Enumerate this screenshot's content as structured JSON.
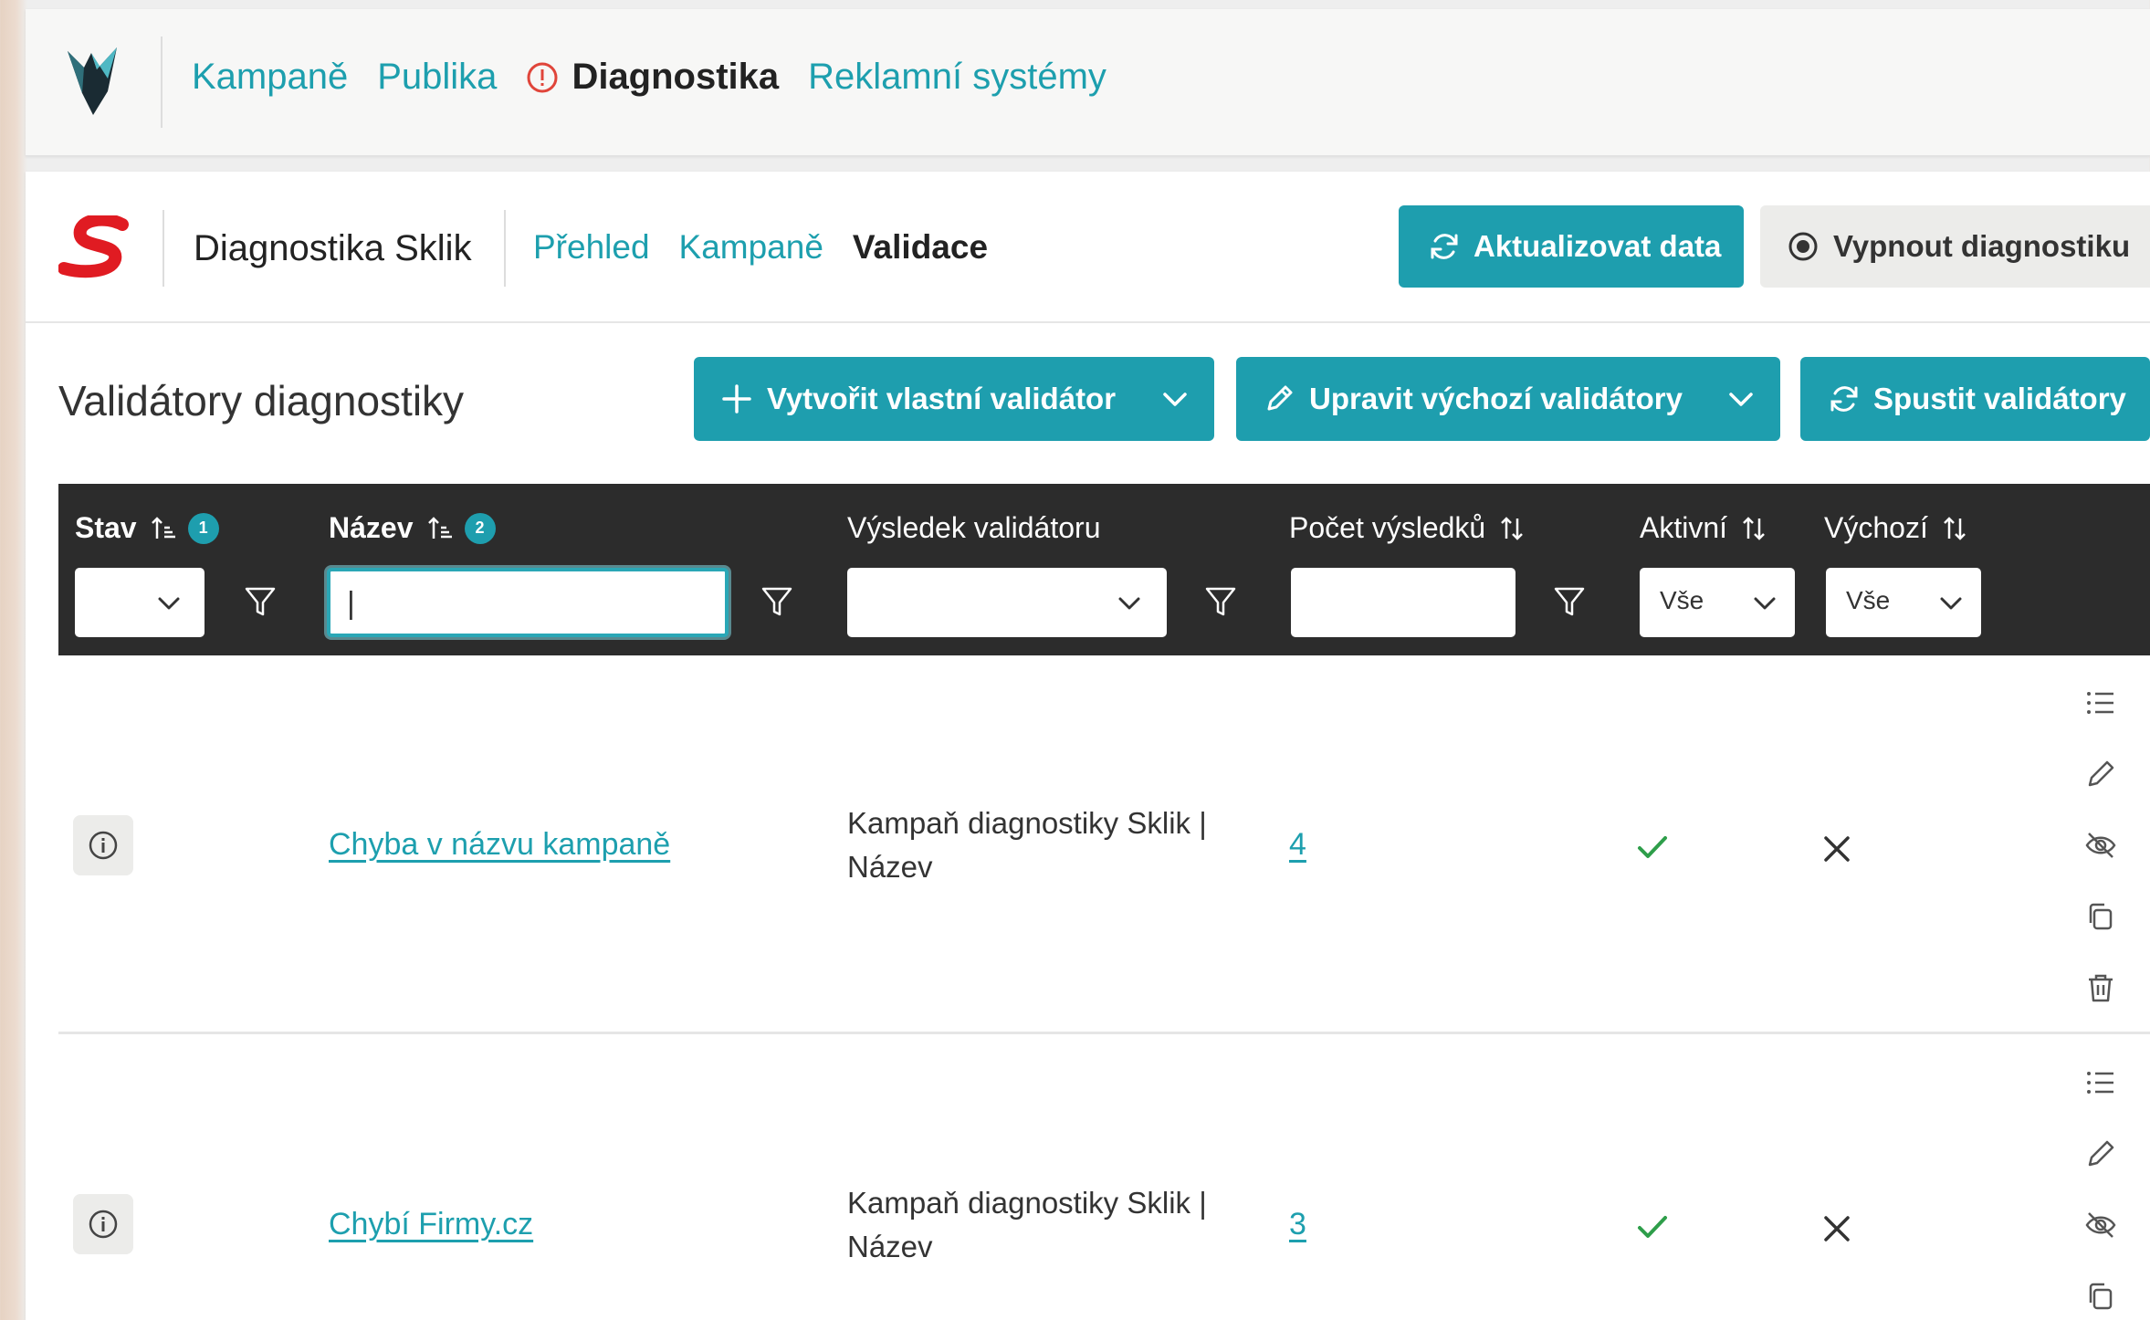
{
  "top_nav": {
    "items": [
      {
        "label": "Kampaně"
      },
      {
        "label": "Publika"
      }
    ],
    "active": {
      "label": "Diagnostika"
    },
    "after": [
      {
        "label": "Reklamní systémy"
      }
    ]
  },
  "sub_header": {
    "title": "Diagnostika Sklik",
    "tabs": [
      {
        "label": "Přehled"
      },
      {
        "label": "Kampaně"
      },
      {
        "label": "Validace",
        "active": true
      }
    ],
    "refresh_label": "Aktualizovat data",
    "disable_label": "Vypnout diagnostiku"
  },
  "toolbar": {
    "title": "Validátory diagnostiky",
    "create_label": "Vytvořit vlastní validátor",
    "edit_label": "Upravit výchozí validátory",
    "run_label": "Spustit validátory"
  },
  "table": {
    "columns": [
      {
        "label": "Stav",
        "badge": "1"
      },
      {
        "label": "Název",
        "badge": "2"
      },
      {
        "label": "Výsledek validátoru"
      },
      {
        "label": "Počet výsledků"
      },
      {
        "label": "Aktivní"
      },
      {
        "label": "Výchozí"
      }
    ],
    "filters": {
      "name_value": "|",
      "aktivni_value": "Vše",
      "vychozi_value": "Vše"
    },
    "rows": [
      {
        "name": "Chyba v názvu kampaně",
        "result_line1": "Kampaň diagnostiky Sklik |",
        "result_line2": "Název",
        "count": "4"
      },
      {
        "name": "Chybí Firmy.cz",
        "result_line1": "Kampaň diagnostiky Sklik |",
        "result_line2": "Název",
        "count": "3"
      }
    ]
  },
  "colors": {
    "accent": "#1e9eae",
    "header_bg": "#2c2c2c",
    "check": "#2e9e4a",
    "brand_red": "#e01b22"
  }
}
